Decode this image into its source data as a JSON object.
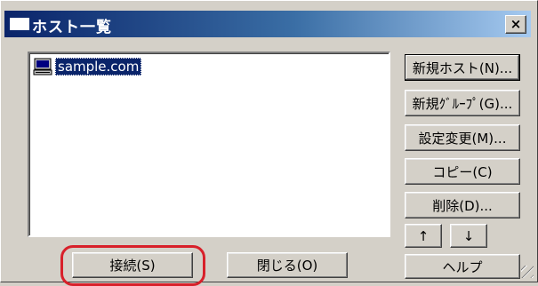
{
  "window": {
    "title": "ホスト一覧",
    "close_label": "×"
  },
  "hosts": [
    {
      "name": "sample.com",
      "icon": "computer-icon",
      "selected": true
    }
  ],
  "side_buttons": {
    "new_host": "新規ホスト(N)...",
    "new_group": "新規ｸﾞﾙｰﾌﾟ(G)...",
    "edit": "設定変更(M)...",
    "copy": "コピー(C)",
    "delete": "削除(D)...",
    "up": "↑",
    "down": "↓",
    "help": "ヘルプ"
  },
  "bottom_buttons": {
    "connect": "接続(S)",
    "close": "閉じる(O)"
  },
  "colors": {
    "titlebar_start": "#0a246a",
    "titlebar_end": "#a6caf0",
    "selection": "#0a246a",
    "highlight_ring": "#d8202a"
  }
}
